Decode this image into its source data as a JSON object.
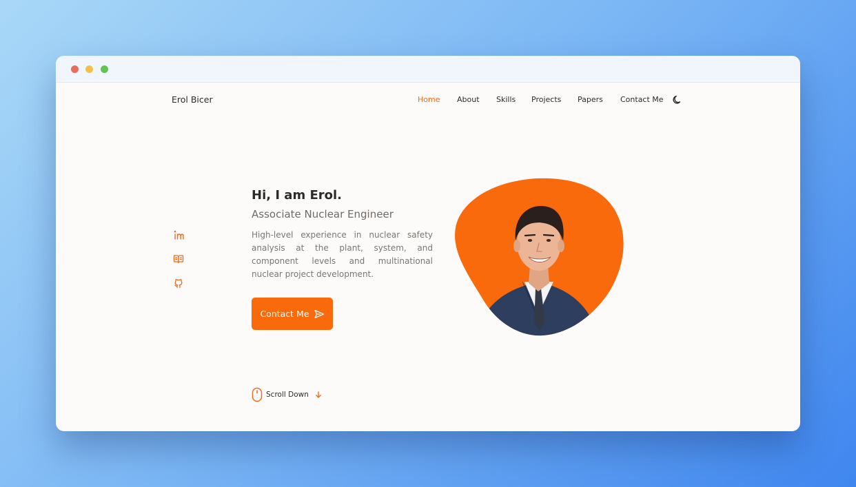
{
  "brand": {
    "name": "Erol Bicer"
  },
  "nav": {
    "items": [
      {
        "label": "Home"
      },
      {
        "label": "About"
      },
      {
        "label": "Skills"
      },
      {
        "label": "Projects"
      },
      {
        "label": "Papers"
      },
      {
        "label": "Contact Me"
      }
    ],
    "active": "Home",
    "theme_toggle_icon": "moon-icon"
  },
  "social": {
    "icons": [
      "linkedin-icon",
      "book-icon",
      "github-icon"
    ]
  },
  "hero": {
    "title": "Hi, I am Erol.",
    "subtitle": "Associate Nuclear Engineer",
    "description": "High-level experience in nuclear safety analysis at the plant, system, and component levels and multinational nuclear project development.",
    "cta_label": "Contact Me",
    "cta_icon": "send-icon",
    "portrait_icon": "profile-photo"
  },
  "scroll": {
    "label": "Scroll Down",
    "icons": [
      "mouse-icon",
      "arrow-down-icon"
    ]
  },
  "colors": {
    "accent": "#f86a0c",
    "text": "#2b2b2b",
    "muted": "#7a7571",
    "page_bg": "#fcfbfa"
  }
}
